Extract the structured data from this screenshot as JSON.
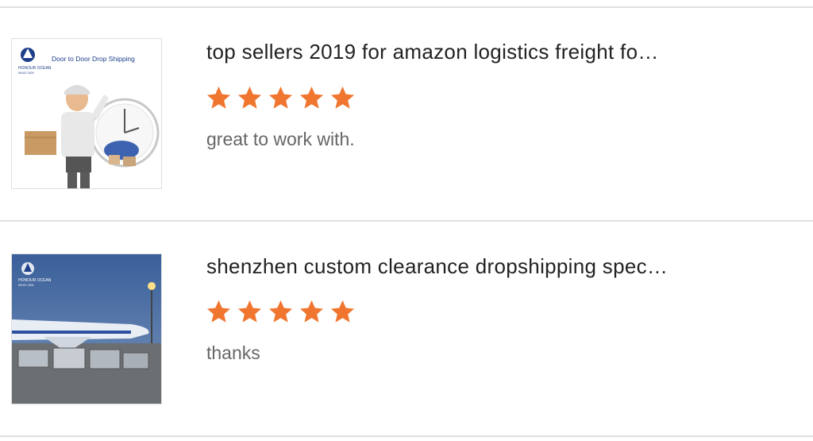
{
  "colors": {
    "star": "#f07630",
    "divider": "#e0e0e0",
    "title": "#222222",
    "comment": "#666666"
  },
  "reviews": [
    {
      "title": "top sellers 2019 for amazon logistics freight fo…",
      "rating": 5,
      "comment": "great to work with.",
      "thumbnail": {
        "banner": "Door to Door Drop Shipping",
        "logo_line1": "HONOUR OCEAN",
        "logo_line2": "SINCE 2009",
        "icon": "delivery-man-with-clock-image"
      }
    },
    {
      "title": "shenzhen custom clearance dropshipping spec…",
      "rating": 5,
      "comment": "thanks",
      "thumbnail": {
        "logo_line1": "HONOUR OCEAN",
        "logo_line2": "SINCE 2009",
        "icon": "cargo-airplane-image"
      }
    }
  ]
}
